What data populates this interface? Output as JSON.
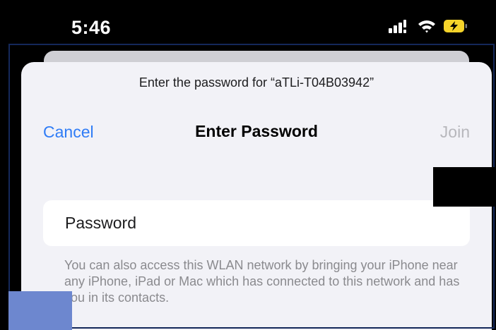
{
  "status_bar": {
    "time": "5:46",
    "icons": [
      "cellular-signal-icon",
      "wifi-icon",
      "battery-charging-icon"
    ],
    "battery_color": "#f5d32a"
  },
  "sheet": {
    "prompt": "Enter the password for “aTLi-T04B03942”",
    "cancel_label": "Cancel",
    "title": "Enter Password",
    "join_label": "Join",
    "password": {
      "value": "",
      "placeholder": "Password"
    },
    "footnote": "You can also access this WLAN network by bringing your iPhone near any iPhone, iPad or Mac which has connected to this network and has you in its contacts."
  },
  "colors": {
    "accent": "#2f7cf6",
    "disabled": "#b7b7bc",
    "sheet_background": "#f2f2f7",
    "secondary_text": "#8a8a8e"
  }
}
